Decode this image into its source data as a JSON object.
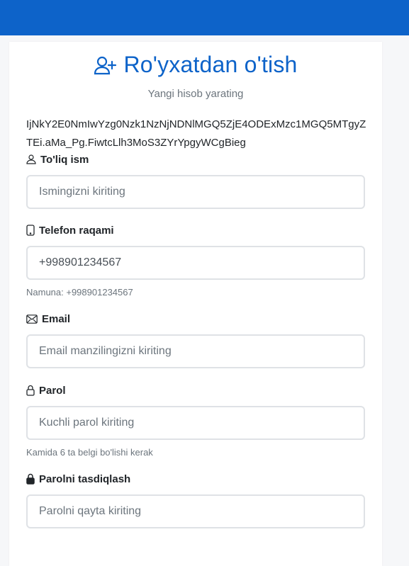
{
  "header": {
    "title": "Ro'yxatdan o'tish",
    "subtitle": "Yangi hisob yarating",
    "icon": "user-plus-icon"
  },
  "token_text": "IjNkY2E0NmIwYzg0Nzk1NzNjNDNlMGQ5ZjE4ODExMzc1MGQ5MTgyZTEi.aMa_Pg.FiwtcLlh3MoS3ZYrYpgyWCgBieg",
  "fields": {
    "fullname": {
      "label": "To'liq ism",
      "placeholder": "Ismingizni kiriting",
      "icon": "person-icon"
    },
    "phone": {
      "label": "Telefon raqami",
      "value": "+998901234567",
      "hint": "Namuna: +998901234567",
      "icon": "phone-icon"
    },
    "email": {
      "label": "Email",
      "placeholder": "Email manzilingizni kiriting",
      "icon": "envelope-icon"
    },
    "password": {
      "label": "Parol",
      "placeholder": "Kuchli parol kiriting",
      "hint": "Kamida 6 ta belgi bo'lishi kerak",
      "icon": "lock-outline-icon"
    },
    "confirm": {
      "label": "Parolni tasdiqlash",
      "placeholder": "Parolni qayta kiriting",
      "icon": "lock-filled-icon"
    }
  },
  "colors": {
    "primary": "#0d63c9",
    "muted": "#6c757d",
    "border": "#dfe2e6"
  }
}
